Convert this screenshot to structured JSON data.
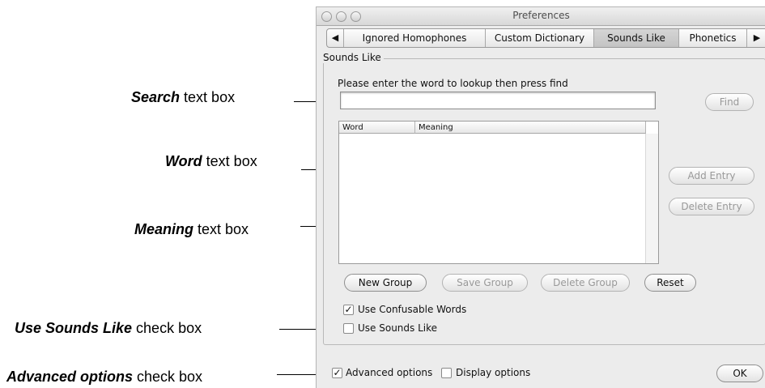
{
  "callouts": {
    "search": {
      "bold": "Search",
      "rest": " text box"
    },
    "word": {
      "bold": "Word",
      "rest": " text box"
    },
    "meaning": {
      "bold": "Meaning",
      "rest": " text box"
    },
    "use_sounds_like": {
      "bold": "Use Sounds Like",
      "rest": " check box"
    },
    "advanced_options": {
      "bold": "Advanced options",
      "rest": " check box"
    }
  },
  "window": {
    "title": "Preferences",
    "tabs": [
      {
        "label": "Ignored Homophones",
        "selected": false
      },
      {
        "label": "Custom Dictionary",
        "selected": false
      },
      {
        "label": "Sounds Like",
        "selected": true
      },
      {
        "label": "Phonetics",
        "selected": false
      }
    ],
    "tab_left_arrow": "◀",
    "tab_right_arrow": "▶"
  },
  "sounds_like": {
    "group_label": "Sounds Like",
    "prompt": "Please enter the word to lookup then press find",
    "search_value": "",
    "find_button": "Find",
    "table_headers": [
      "Word",
      "Meaning"
    ],
    "add_entry_button": "Add Entry",
    "delete_entry_button": "Delete Entry",
    "new_group_button": "New Group",
    "save_group_button": "Save Group",
    "delete_group_button": "Delete Group",
    "reset_button": "Reset",
    "use_confusable_words": {
      "label": "Use Confusable Words",
      "checked": true
    },
    "use_sounds_like": {
      "label": "Use Sounds Like",
      "checked": false
    }
  },
  "footer": {
    "advanced_options": {
      "label": "Advanced options",
      "checked": true
    },
    "display_options": {
      "label": "Display options",
      "checked": false
    },
    "ok_button": "OK"
  },
  "check_glyph": "✓"
}
